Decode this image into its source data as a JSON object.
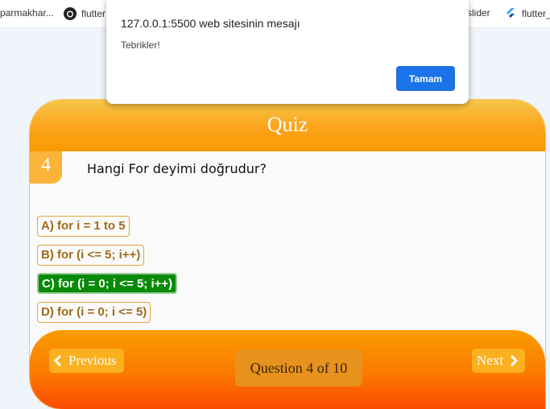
{
  "bookmarks": [
    {
      "label": "parmakhar..."
    },
    {
      "label": "flutter"
    },
    {
      "label": "slider"
    },
    {
      "label": "flutter_"
    }
  ],
  "alert": {
    "title": "127.0.0.1:5500 web sitesinin mesajı",
    "message": "Tebrikler!",
    "ok_label": "Tamam"
  },
  "quiz": {
    "title": "Quiz",
    "question_number": "4",
    "question_text": "Hangi For deyimi doğrudur?",
    "options": [
      {
        "label": "A) for i = 1 to 5",
        "selected": false
      },
      {
        "label": "B) for (i <= 5; i++)",
        "selected": false
      },
      {
        "label": "C) for (i = 0; i <= 5; i++)",
        "selected": true
      },
      {
        "label": "D) for (i = 0; i <= 5)",
        "selected": false
      }
    ],
    "previous_label": "Previous",
    "next_label": "Next",
    "counter": "Question 4 of 10"
  },
  "colors": {
    "header_orange": "#fba31a",
    "footer_orange": "#fb7a00",
    "selected_green": "#088a08",
    "alert_button": "#1a73e8"
  }
}
